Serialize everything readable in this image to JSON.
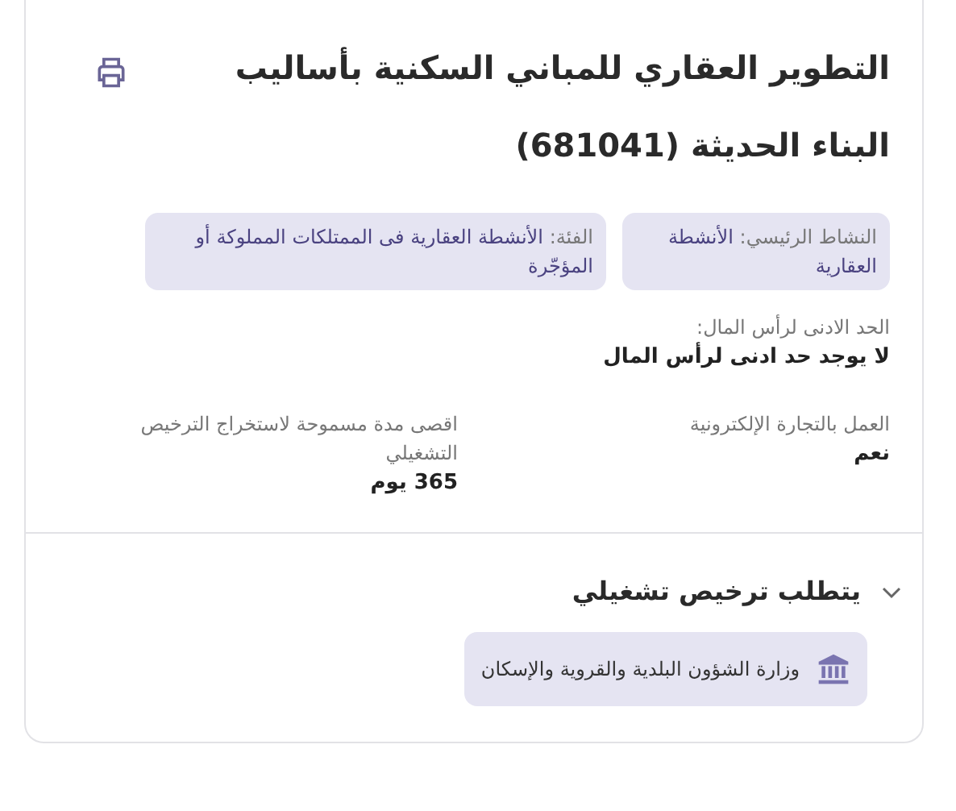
{
  "title": "التطوير العقاري للمباني السكنية بأساليب البناء الحديثة (681041)",
  "tags": [
    {
      "label": "النشاط الرئيسي:",
      "value": "الأنشطة العقارية"
    },
    {
      "label": "الفئة:",
      "value": "الأنشطة العقارية فى الممتلكات المملوكة أو المؤجّرة"
    }
  ],
  "capital": {
    "label": "الحد الادنى لرأس المال:",
    "value": "لا يوجد حد ادنى لرأس المال"
  },
  "fields": [
    {
      "label": "العمل بالتجارة الإلكترونية",
      "value": "نعم"
    },
    {
      "label": "اقصى مدة مسموحة لاستخراج الترخيص التشغيلي",
      "value": "365 يوم"
    }
  ],
  "license_section": {
    "title": "يتطلب ترخيص تشغيلي",
    "expanded": true,
    "authorities": [
      "وزارة الشؤون البلدية والقروية والإسكان"
    ]
  }
}
